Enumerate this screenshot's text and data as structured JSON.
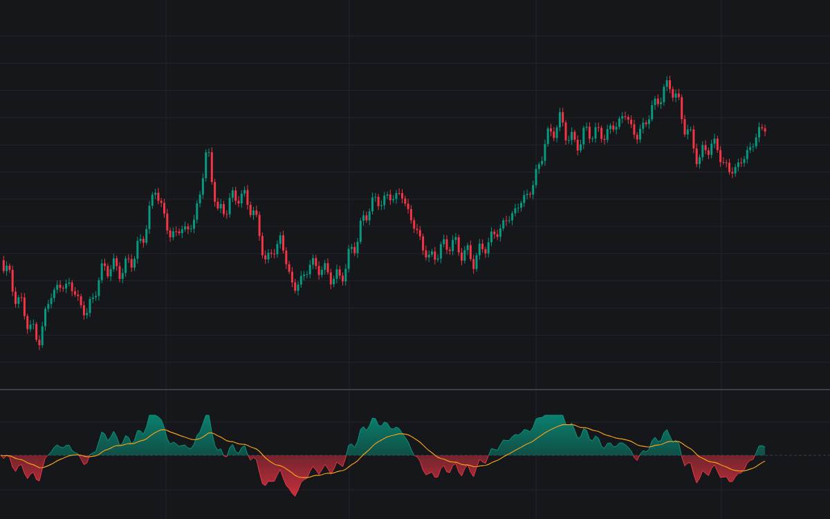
{
  "panes": [
    {
      "kind": "candlestick"
    },
    {
      "kind": "oscillator"
    }
  ]
}
